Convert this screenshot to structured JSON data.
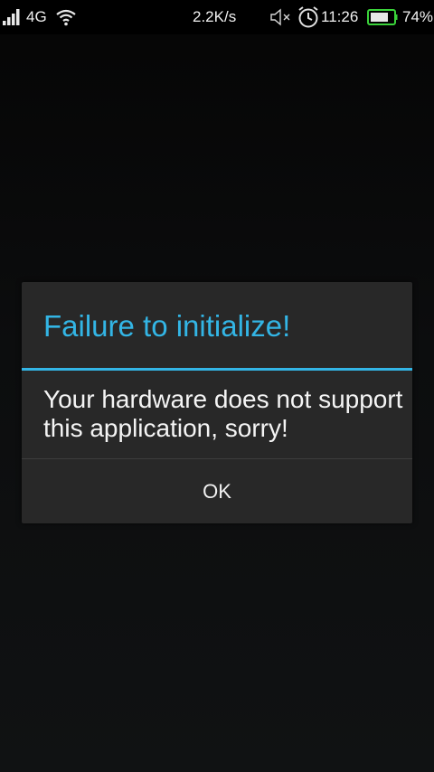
{
  "status_bar": {
    "network_type": "4G",
    "speed": "2.2K/s",
    "time": "11:26",
    "battery_percent": "74%",
    "battery_level": 0.74,
    "icons": [
      "signal-icon",
      "wifi-icon",
      "mute-icon",
      "alarm-icon",
      "battery-icon"
    ],
    "battery_color": "#3ad33a"
  },
  "dialog": {
    "title": "Failure to initialize!",
    "message": "Your hardware does not support this application, sorry!",
    "ok_label": "OK",
    "accent_color": "#33b5e5"
  }
}
